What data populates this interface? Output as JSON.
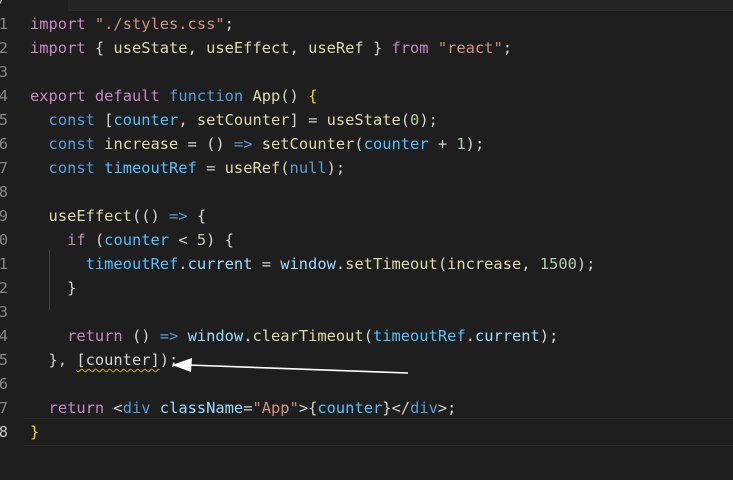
{
  "tab": {
    "glyph": ")"
  },
  "editor": {
    "line_numbers": [
      "1",
      "2",
      "3",
      "4",
      "5",
      "6",
      "7",
      "8",
      "9",
      "0",
      "1",
      "2",
      "3",
      "4",
      "5",
      "6",
      "7",
      "8"
    ],
    "active_line_index": 17,
    "lines": [
      {
        "tokens": [
          {
            "t": "import",
            "c": "kw-pink"
          },
          {
            "t": " ",
            "c": "punct"
          },
          {
            "t": "\"./styles.css\"",
            "c": "str"
          },
          {
            "t": ";",
            "c": "punct"
          }
        ]
      },
      {
        "tokens": [
          {
            "t": "import",
            "c": "kw-pink"
          },
          {
            "t": " { ",
            "c": "punct"
          },
          {
            "t": "useState",
            "c": "fn"
          },
          {
            "t": ", ",
            "c": "punct"
          },
          {
            "t": "useEffect",
            "c": "fn"
          },
          {
            "t": ", ",
            "c": "punct"
          },
          {
            "t": "useRef",
            "c": "fn"
          },
          {
            "t": " } ",
            "c": "punct"
          },
          {
            "t": "from",
            "c": "kw-pink"
          },
          {
            "t": " ",
            "c": "punct"
          },
          {
            "t": "\"react\"",
            "c": "str"
          },
          {
            "t": ";",
            "c": "punct"
          }
        ]
      },
      {
        "tokens": []
      },
      {
        "tokens": [
          {
            "t": "export",
            "c": "kw-pink"
          },
          {
            "t": " ",
            "c": "punct"
          },
          {
            "t": "default",
            "c": "kw-pink"
          },
          {
            "t": " ",
            "c": "punct"
          },
          {
            "t": "function",
            "c": "kw-blue"
          },
          {
            "t": " ",
            "c": "punct"
          },
          {
            "t": "App",
            "c": "fn"
          },
          {
            "t": "() ",
            "c": "punct"
          },
          {
            "t": "{",
            "c": "brace"
          }
        ]
      },
      {
        "tokens": [
          {
            "t": "  ",
            "c": "punct"
          },
          {
            "t": "const",
            "c": "kw-blue"
          },
          {
            "t": " [",
            "c": "punct"
          },
          {
            "t": "counter",
            "c": "const"
          },
          {
            "t": ", ",
            "c": "punct"
          },
          {
            "t": "setCounter",
            "c": "fn"
          },
          {
            "t": "] = ",
            "c": "punct"
          },
          {
            "t": "useState",
            "c": "fn"
          },
          {
            "t": "(",
            "c": "punct"
          },
          {
            "t": "0",
            "c": "num"
          },
          {
            "t": ");",
            "c": "punct"
          }
        ]
      },
      {
        "tokens": [
          {
            "t": "  ",
            "c": "punct"
          },
          {
            "t": "const",
            "c": "kw-blue"
          },
          {
            "t": " ",
            "c": "punct"
          },
          {
            "t": "increase",
            "c": "fn"
          },
          {
            "t": " = () ",
            "c": "punct"
          },
          {
            "t": "=>",
            "c": "kw-blue"
          },
          {
            "t": " ",
            "c": "punct"
          },
          {
            "t": "setCounter",
            "c": "fn"
          },
          {
            "t": "(",
            "c": "punct"
          },
          {
            "t": "counter",
            "c": "const"
          },
          {
            "t": " + ",
            "c": "punct"
          },
          {
            "t": "1",
            "c": "num"
          },
          {
            "t": ");",
            "c": "punct"
          }
        ]
      },
      {
        "tokens": [
          {
            "t": "  ",
            "c": "punct"
          },
          {
            "t": "const",
            "c": "kw-blue"
          },
          {
            "t": " ",
            "c": "punct"
          },
          {
            "t": "timeoutRef",
            "c": "const"
          },
          {
            "t": " = ",
            "c": "punct"
          },
          {
            "t": "useRef",
            "c": "fn"
          },
          {
            "t": "(",
            "c": "punct"
          },
          {
            "t": "null",
            "c": "kw-blue"
          },
          {
            "t": ");",
            "c": "punct"
          }
        ]
      },
      {
        "tokens": []
      },
      {
        "tokens": [
          {
            "t": "  ",
            "c": "punct"
          },
          {
            "t": "useEffect",
            "c": "fn"
          },
          {
            "t": "(() ",
            "c": "punct"
          },
          {
            "t": "=>",
            "c": "kw-blue"
          },
          {
            "t": " {",
            "c": "punct"
          }
        ]
      },
      {
        "tokens": [
          {
            "t": "    ",
            "c": "punct"
          },
          {
            "t": "if",
            "c": "kw-pink"
          },
          {
            "t": " (",
            "c": "punct"
          },
          {
            "t": "counter",
            "c": "const"
          },
          {
            "t": " < ",
            "c": "punct"
          },
          {
            "t": "5",
            "c": "num"
          },
          {
            "t": ") {",
            "c": "punct"
          }
        ]
      },
      {
        "tokens": [
          {
            "t": "      ",
            "c": "punct"
          },
          {
            "t": "timeoutRef",
            "c": "const"
          },
          {
            "t": ".",
            "c": "punct"
          },
          {
            "t": "current",
            "c": "var"
          },
          {
            "t": " = ",
            "c": "punct"
          },
          {
            "t": "window",
            "c": "var"
          },
          {
            "t": ".",
            "c": "punct"
          },
          {
            "t": "setTimeout",
            "c": "fn"
          },
          {
            "t": "(",
            "c": "punct"
          },
          {
            "t": "increase",
            "c": "fn"
          },
          {
            "t": ", ",
            "c": "punct"
          },
          {
            "t": "1500",
            "c": "num"
          },
          {
            "t": ");",
            "c": "punct"
          }
        ]
      },
      {
        "tokens": [
          {
            "t": "    }",
            "c": "punct"
          }
        ]
      },
      {
        "tokens": []
      },
      {
        "tokens": [
          {
            "t": "    ",
            "c": "punct"
          },
          {
            "t": "return",
            "c": "kw-pink"
          },
          {
            "t": " () ",
            "c": "punct"
          },
          {
            "t": "=>",
            "c": "kw-blue"
          },
          {
            "t": " ",
            "c": "punct"
          },
          {
            "t": "window",
            "c": "var"
          },
          {
            "t": ".",
            "c": "punct"
          },
          {
            "t": "clearTimeout",
            "c": "fn"
          },
          {
            "t": "(",
            "c": "punct"
          },
          {
            "t": "timeoutRef",
            "c": "const"
          },
          {
            "t": ".",
            "c": "punct"
          },
          {
            "t": "current",
            "c": "var"
          },
          {
            "t": ");",
            "c": "punct"
          }
        ]
      },
      {
        "tokens": [
          {
            "t": "  }, ",
            "c": "punct"
          },
          {
            "t": "[counter]",
            "c": "squiggle-const"
          },
          {
            "t": ");",
            "c": "punct"
          }
        ]
      },
      {
        "tokens": []
      },
      {
        "tokens": [
          {
            "t": "  ",
            "c": "punct"
          },
          {
            "t": "return",
            "c": "kw-pink"
          },
          {
            "t": " <",
            "c": "punct"
          },
          {
            "t": "div",
            "c": "tag"
          },
          {
            "t": " ",
            "c": "punct"
          },
          {
            "t": "className",
            "c": "attr"
          },
          {
            "t": "=",
            "c": "punct"
          },
          {
            "t": "\"App\"",
            "c": "str"
          },
          {
            "t": ">{",
            "c": "punct"
          },
          {
            "t": "counter",
            "c": "const"
          },
          {
            "t": "}</",
            "c": "punct"
          },
          {
            "t": "div",
            "c": "tag"
          },
          {
            "t": ">;",
            "c": "punct"
          }
        ]
      },
      {
        "tokens": [
          {
            "t": "}",
            "c": "brace"
          }
        ]
      }
    ]
  },
  "annotation": {
    "arrow_color": "#ffffff"
  }
}
